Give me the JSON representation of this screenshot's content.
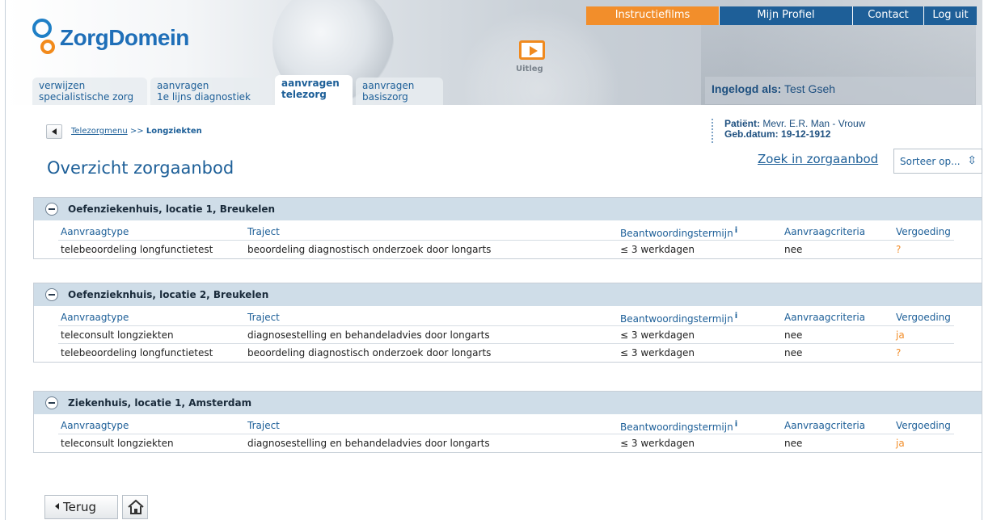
{
  "header": {
    "logo_text": "ZorgDomein",
    "uitleg_label": "Uitleg",
    "top_links": [
      "Instructiefilms",
      "Mijn Profiel",
      "Contact",
      "Log uit"
    ],
    "tabs": [
      {
        "line1": "verwijzen",
        "line2": "specialistische zorg"
      },
      {
        "line1": "aanvragen",
        "line2": "1e lijns diagnostiek"
      },
      {
        "line1": "aanvragen",
        "line2": "telezorg"
      },
      {
        "line1": "aanvragen",
        "line2": "basiszorg"
      }
    ],
    "logged_in_label": "Ingelogd als:",
    "logged_in_user": "Test Gseh",
    "accent_orange": "#f28e2b",
    "accent_blue": "#1e5f98"
  },
  "breadcrumb": {
    "parent": "Telezorgmenu",
    "separator": ">>",
    "current": "Longziekten"
  },
  "patient": {
    "label": "Patiënt:",
    "value": "Mevr. E.R. Man - Vrouw",
    "dob_label": "Geb.datum:",
    "dob_value": "19-12-1912"
  },
  "page": {
    "title": "Overzicht zorgaanbod",
    "search_link": "Zoek in zorgaanbod",
    "sort_label": "Sorteer op..."
  },
  "columns": {
    "c1": "Aanvraagtype",
    "c2": "Traject",
    "c3": "Beantwoordingstermijn",
    "c3_info": "i",
    "c4": "Aanvraagcriteria",
    "c5": "Vergoeding"
  },
  "groups": [
    {
      "name": "Oefenziekenhuis, locatie 1, Breukelen",
      "rows": [
        {
          "type": "telebeoordeling longfunctietest",
          "traject": "beoordeling diagnostisch onderzoek door longarts",
          "termijn": "≤ 3 werkdagen",
          "criteria": "nee",
          "vergoeding": "?"
        }
      ]
    },
    {
      "name": "Oefenzieknhuis, locatie 2, Breukelen",
      "rows": [
        {
          "type": "teleconsult longziekten",
          "traject": "diagnosestelling en behandeladvies door longarts",
          "termijn": "≤ 3 werkdagen",
          "criteria": "nee",
          "vergoeding": "ja"
        },
        {
          "type": "telebeoordeling longfunctietest",
          "traject": "beoordeling diagnostisch onderzoek door longarts",
          "termijn": "≤ 3 werkdagen",
          "criteria": "nee",
          "vergoeding": "?"
        }
      ]
    },
    {
      "name": "Ziekenhuis, locatie 1, Amsterdam",
      "rows": [
        {
          "type": "teleconsult longziekten",
          "traject": "diagnosestelling en behandeladvies door longarts",
          "termijn": "≤ 3 werkdagen",
          "criteria": "nee",
          "vergoeding": "ja"
        }
      ]
    }
  ],
  "footer": {
    "back_label": "Terug",
    "home_icon": "home-icon"
  }
}
